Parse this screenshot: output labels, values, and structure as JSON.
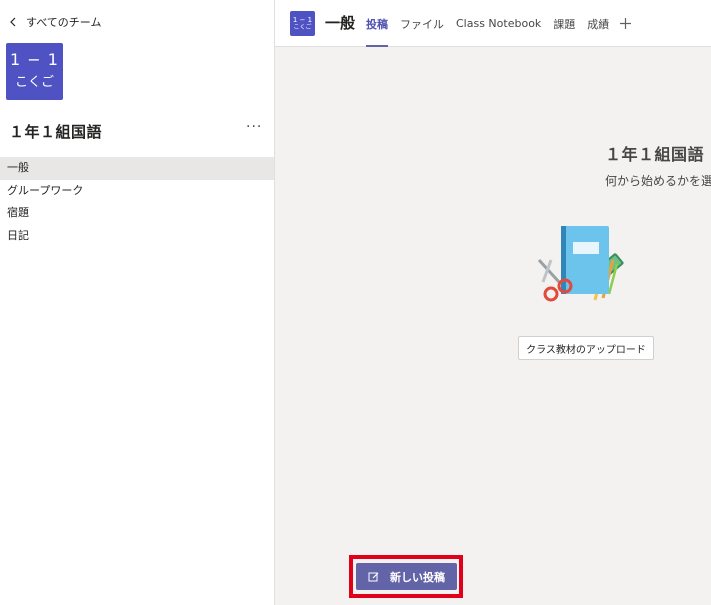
{
  "sidebar": {
    "back_label": "すべてのチーム",
    "team_tile": {
      "line1": "1 − 1",
      "line2": "こくご"
    },
    "team_name": "１年１組国語",
    "more_label": "···",
    "channels": [
      {
        "label": "一般",
        "active": true
      },
      {
        "label": "グループワーク",
        "active": false
      },
      {
        "label": "宿題",
        "active": false
      },
      {
        "label": "日記",
        "active": false
      }
    ]
  },
  "topbar": {
    "mini_tile": {
      "line1": "1 − 1",
      "line2": "こくご"
    },
    "channel_title": "一般",
    "tabs": [
      {
        "label": "投稿",
        "active": true
      },
      {
        "label": "ファイル",
        "active": false
      },
      {
        "label": "Class Notebook",
        "active": false
      },
      {
        "label": "課題",
        "active": false
      },
      {
        "label": "成績",
        "active": false
      }
    ]
  },
  "welcome": {
    "title": "１年１組国語",
    "subtitle": "何から始めるかを選"
  },
  "upload_button_label": "クラス教材のアップロード",
  "new_post_label": "新しい投稿",
  "colors": {
    "accent": "#6264a7",
    "tile": "#4f52c3",
    "highlight": "#e0001a"
  },
  "icons": [
    "chevron-left-icon",
    "more-icon",
    "add-tab-icon",
    "compose-icon",
    "notebook-scissors-illustration"
  ]
}
